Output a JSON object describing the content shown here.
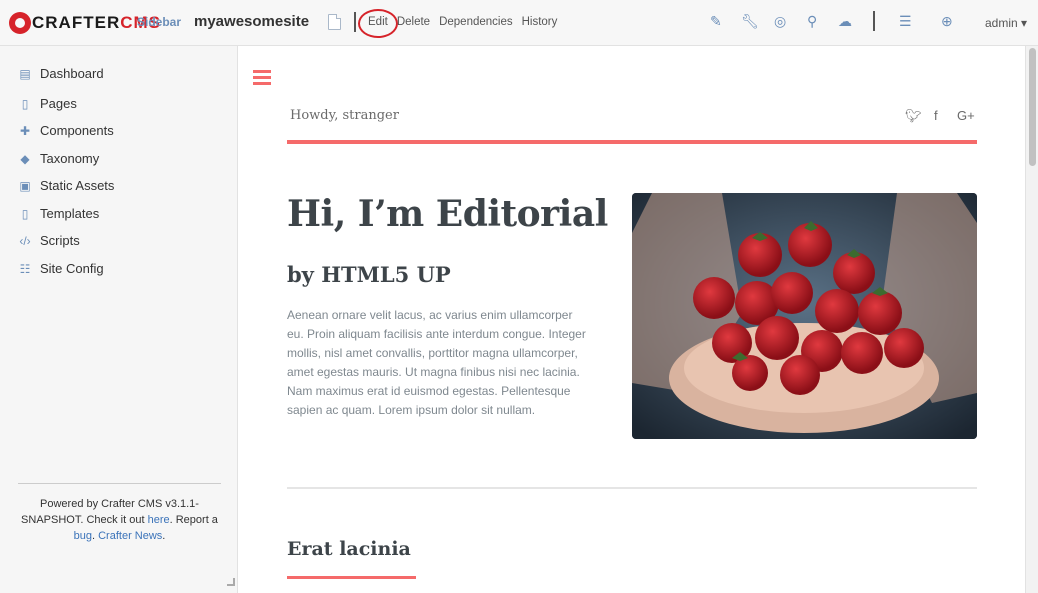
{
  "app": {
    "logo_a": "CRAFTER",
    "logo_b": "CMS",
    "sidebar_toggle": "Sidebar",
    "site_name": "myawesomesite",
    "actions": [
      "Edit",
      "Delete",
      "Dependencies",
      "History"
    ],
    "tools": [
      "pencil-icon",
      "wrench-icon",
      "target-icon",
      "search-icon",
      "cloud-upload-icon",
      "menu-icon",
      "help-icon"
    ],
    "user": "admin"
  },
  "sidebar": {
    "items": [
      {
        "label": "Dashboard",
        "icon": "dashboard-icon"
      },
      {
        "label": "Pages",
        "icon": "page-icon"
      },
      {
        "label": "Components",
        "icon": "puzzle-icon"
      },
      {
        "label": "Taxonomy",
        "icon": "tags-icon"
      },
      {
        "label": "Static Assets",
        "icon": "image-icon"
      },
      {
        "label": "Templates",
        "icon": "file-code-icon"
      },
      {
        "label": "Scripts",
        "icon": "code-icon"
      },
      {
        "label": "Site Config",
        "icon": "sliders-icon"
      }
    ],
    "footer": {
      "line1": "Powered by Crafter CMS v3.1.1-SNAPSHOT. Check it out ",
      "here": "here",
      "line2": ". Report a ",
      "bug": "bug",
      "sep": ". ",
      "news": "Crafter News",
      "end": "."
    }
  },
  "preview": {
    "greeting": "Howdy, stranger",
    "social": [
      "twitter-icon",
      "facebook-icon",
      "google-plus-icon"
    ],
    "heading": "Hi, I’m Editorial",
    "subheading": "by HTML5 UP",
    "body": "Aenean ornare velit lacus, ac varius enim ullamcorper eu. Proin aliquam facilisis ante interdum congue. Integer mollis, nisl amet convallis, porttitor magna ullamcorper, amet egestas mauris. Ut magna finibus nisi nec lacinia. Nam maximus erat id euismod egestas. Pellentesque sapien ac quam. Lorem ipsum dolor sit nullam.",
    "section_title": "Erat lacinia"
  },
  "colors": {
    "brand_red": "#d6232a",
    "accent": "#f56a6a",
    "link": "#3b73b9"
  }
}
